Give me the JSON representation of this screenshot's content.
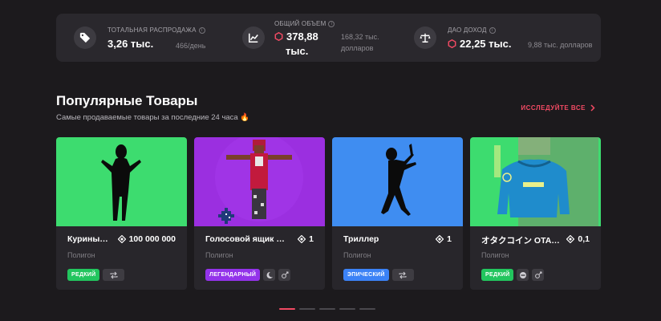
{
  "stats": [
    {
      "label": "ТОТАЛЬНАЯ РАСПРОДАЖА",
      "value": "3,26 тыс.",
      "sub": "466/день",
      "icon": "tag-icon"
    },
    {
      "label": "ОБЩИЙ ОБЪЕМ",
      "value_line1": "378,88",
      "value_line2": "тыс.",
      "sub_line1": "168,32 тыс.",
      "sub_line2": "долларов",
      "icon": "chart-icon"
    },
    {
      "label": "ДАО ДОХОД",
      "value": "22,25 тыс.",
      "sub": "9,88 тыс. долларов",
      "icon": "scale-icon"
    }
  ],
  "section": {
    "title": "Популярные Товары",
    "subtitle": "Самые продаваемые товары за последние 24 часа 🔥",
    "explore_label": "ИССЛЕДУЙТЕ ВСЕ"
  },
  "cards": [
    {
      "name": "Курины…",
      "price": "100 000 000",
      "network": "Полигон",
      "rarity": "РЕДКИЙ",
      "rarity_color": "#22c55e",
      "bg": "#3ddc6f"
    },
    {
      "name": "Голосовой ящик #…",
      "price": "1",
      "network": "Полигон",
      "rarity": "ЛЕГЕНДАРНЫЙ",
      "rarity_color": "#9333ea",
      "bg": "#9b2fe0"
    },
    {
      "name": "Триллер",
      "price": "1",
      "network": "Полигон",
      "rarity": "ЭПИЧЕСКИЙ",
      "rarity_color": "#3b82f6",
      "bg": "#3f8df1"
    },
    {
      "name": "オタクコイン OTA…",
      "price": "0,1",
      "network": "Полигон",
      "rarity": "РЕДКИЙ",
      "rarity_color": "#22c55e",
      "bg": "#3ddc6f"
    }
  ],
  "colors": {
    "accent": "#f24a63",
    "background": "#1c1a1d",
    "card": "#28262b"
  },
  "pager": {
    "count": 5,
    "active": 0
  }
}
